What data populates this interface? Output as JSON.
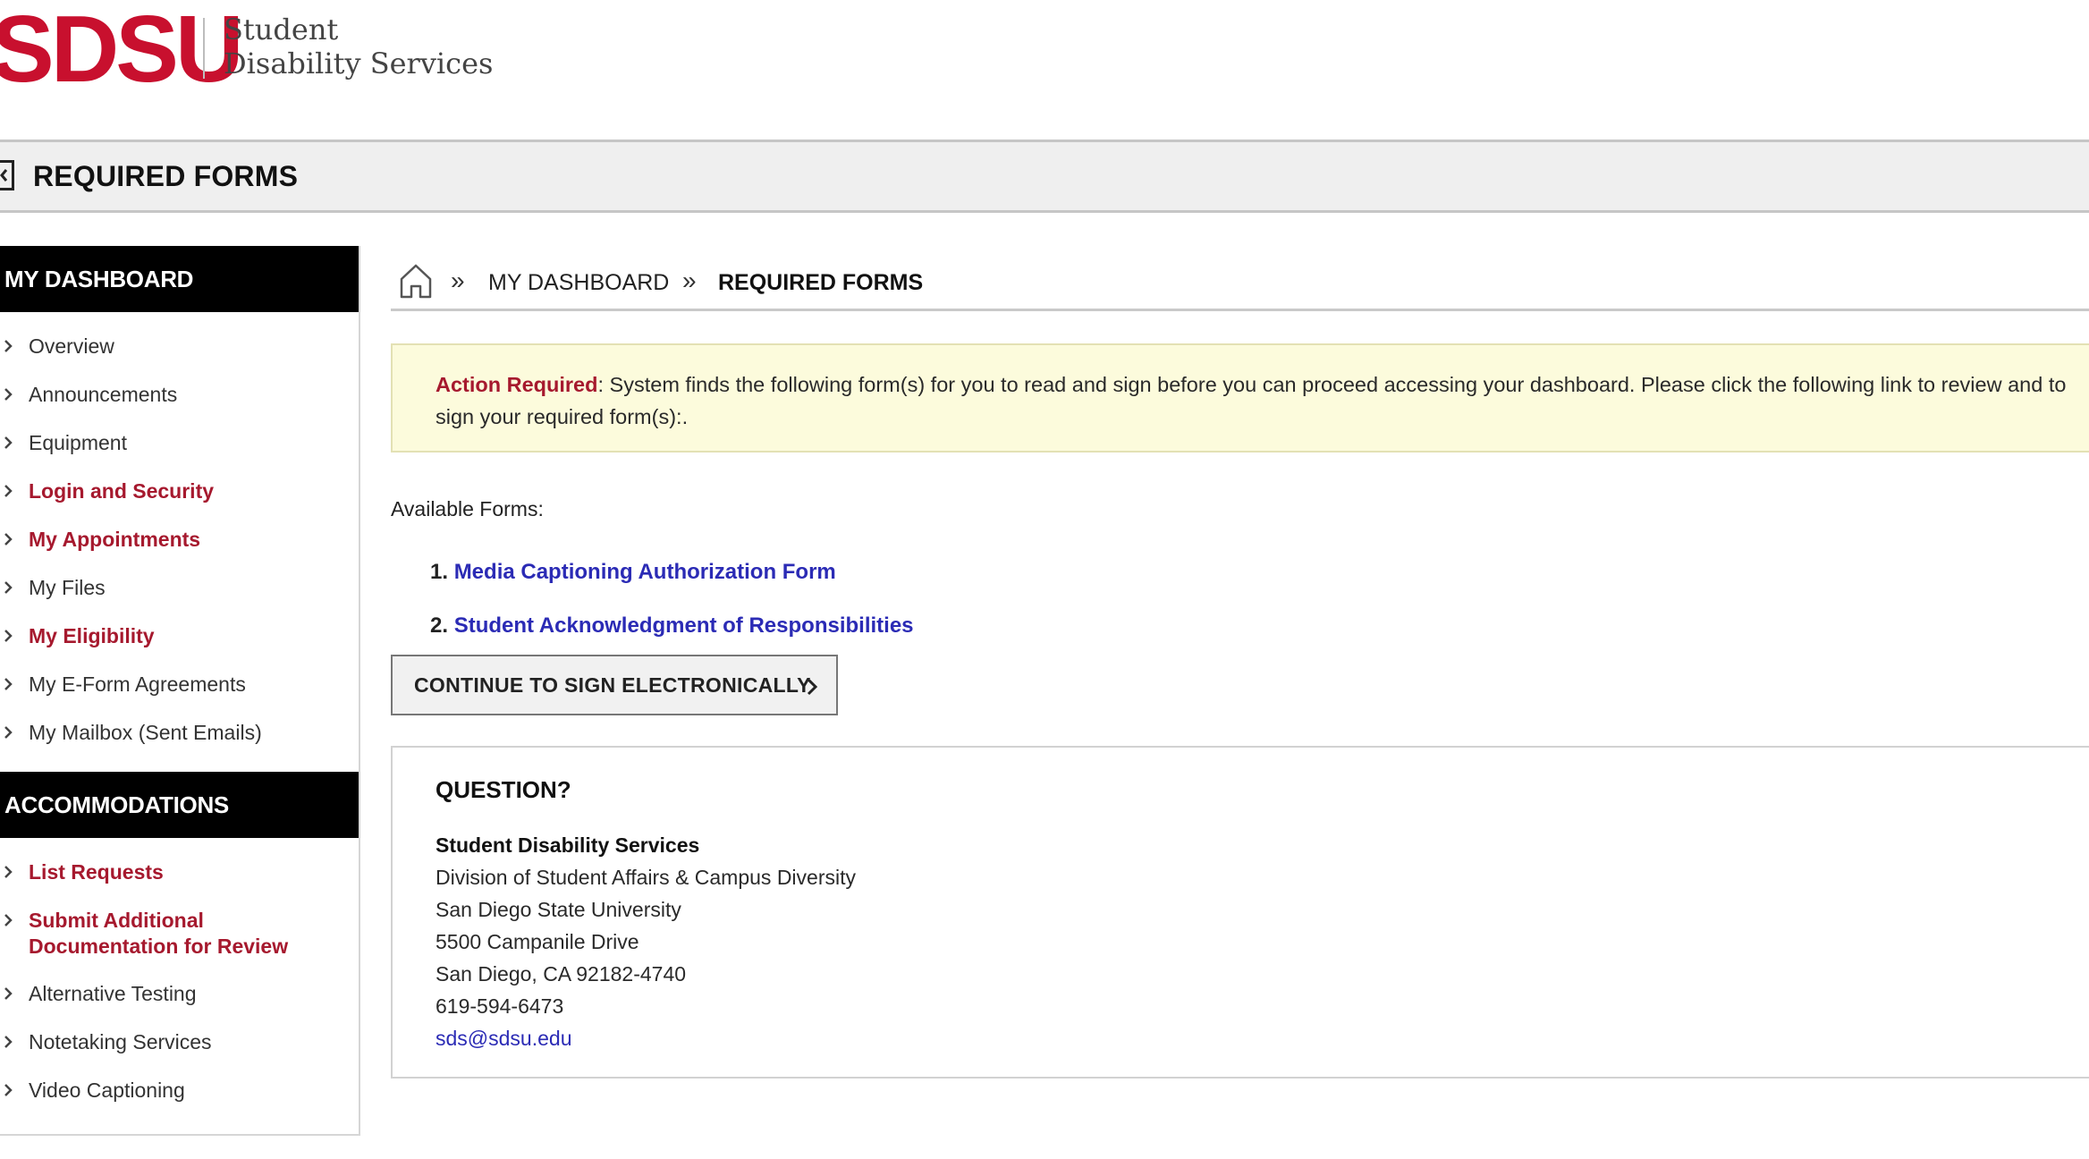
{
  "header": {
    "logo": "SDSU",
    "dept_line1": "Student",
    "dept_line2": "Disability Services"
  },
  "title_bar": {
    "title": "REQUIRED FORMS",
    "back_icon": "collapse-icon"
  },
  "sidebar": {
    "dashboard_heading": "MY DASHBOARD",
    "dashboard_items": [
      {
        "label": "Overview",
        "highlight": false
      },
      {
        "label": "Announcements",
        "highlight": false
      },
      {
        "label": "Equipment",
        "highlight": false
      },
      {
        "label": "Login and Security",
        "highlight": true
      },
      {
        "label": "My Appointments",
        "highlight": true
      },
      {
        "label": "My Files",
        "highlight": false
      },
      {
        "label": "My Eligibility",
        "highlight": true
      },
      {
        "label": "My E-Form Agreements",
        "highlight": false
      },
      {
        "label": "My Mailbox (Sent Emails)",
        "highlight": false
      }
    ],
    "accommodations_heading": "ACCOMMODATIONS",
    "accommodation_items": [
      {
        "label": "List Requests",
        "highlight": true
      },
      {
        "label": "Submit Additional Documentation for Review",
        "highlight": true
      },
      {
        "label": "Alternative Testing",
        "highlight": false
      },
      {
        "label": "Notetaking Services",
        "highlight": false
      },
      {
        "label": "Video Captioning",
        "highlight": false
      }
    ]
  },
  "breadcrumb": {
    "home_icon": "home-icon",
    "separator": "»",
    "items": [
      "MY DASHBOARD",
      "REQUIRED FORMS"
    ]
  },
  "alert": {
    "label": "Action Required",
    "text": ": System finds the following form(s) for you to read and sign before you can proceed accessing your dashboard. Please click the following link to review and to sign your required form(s):."
  },
  "forms": {
    "label": "Available Forms:",
    "items": [
      {
        "number": "1.",
        "title": "Media Captioning Authorization Form"
      },
      {
        "number": "2.",
        "title": "Student Acknowledgment of Responsibilities"
      }
    ],
    "continue_button": "CONTINUE TO SIGN ELECTRONICALLY"
  },
  "question": {
    "title": "QUESTION?",
    "org": "Student Disability Services",
    "lines": [
      "Division of Student Affairs & Campus Diversity",
      "San Diego State University",
      "5500 Campanile Drive",
      "San Diego, CA 92182-4740",
      "619-594-6473"
    ],
    "email": "sds@sdsu.edu"
  },
  "colors": {
    "brand_red": "#c8102e",
    "link_red": "#a6192e",
    "link_blue": "#2b2bb5",
    "alert_bg": "#fcfbdc",
    "sidebar_head_bg": "#000000"
  }
}
